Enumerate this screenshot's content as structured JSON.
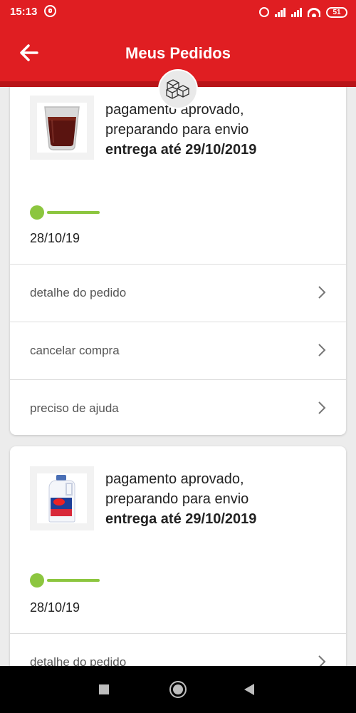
{
  "status_bar": {
    "time": "15:13",
    "battery": "51"
  },
  "header": {
    "title": "Meus Pedidos",
    "back_icon": "arrow-left-icon",
    "badge_icon": "boxes-icon"
  },
  "colors": {
    "brand_red": "#e01e22",
    "progress_green": "#8cc63f"
  },
  "orders": [
    {
      "product_icon": "glass-cup-icon",
      "status_line1": "pagamento aprovado,",
      "status_line2": "preparando para envio",
      "delivery": "entrega até 29/10/2019",
      "date": "28/10/19",
      "actions": [
        "detalhe do pedido",
        "cancelar compra",
        "preciso de ajuda"
      ]
    },
    {
      "product_icon": "detergent-bottle-icon",
      "status_line1": "pagamento aprovado,",
      "status_line2": "preparando para envio",
      "delivery": "entrega até 29/10/2019",
      "date": "28/10/19",
      "actions": [
        "detalhe do pedido"
      ]
    }
  ]
}
